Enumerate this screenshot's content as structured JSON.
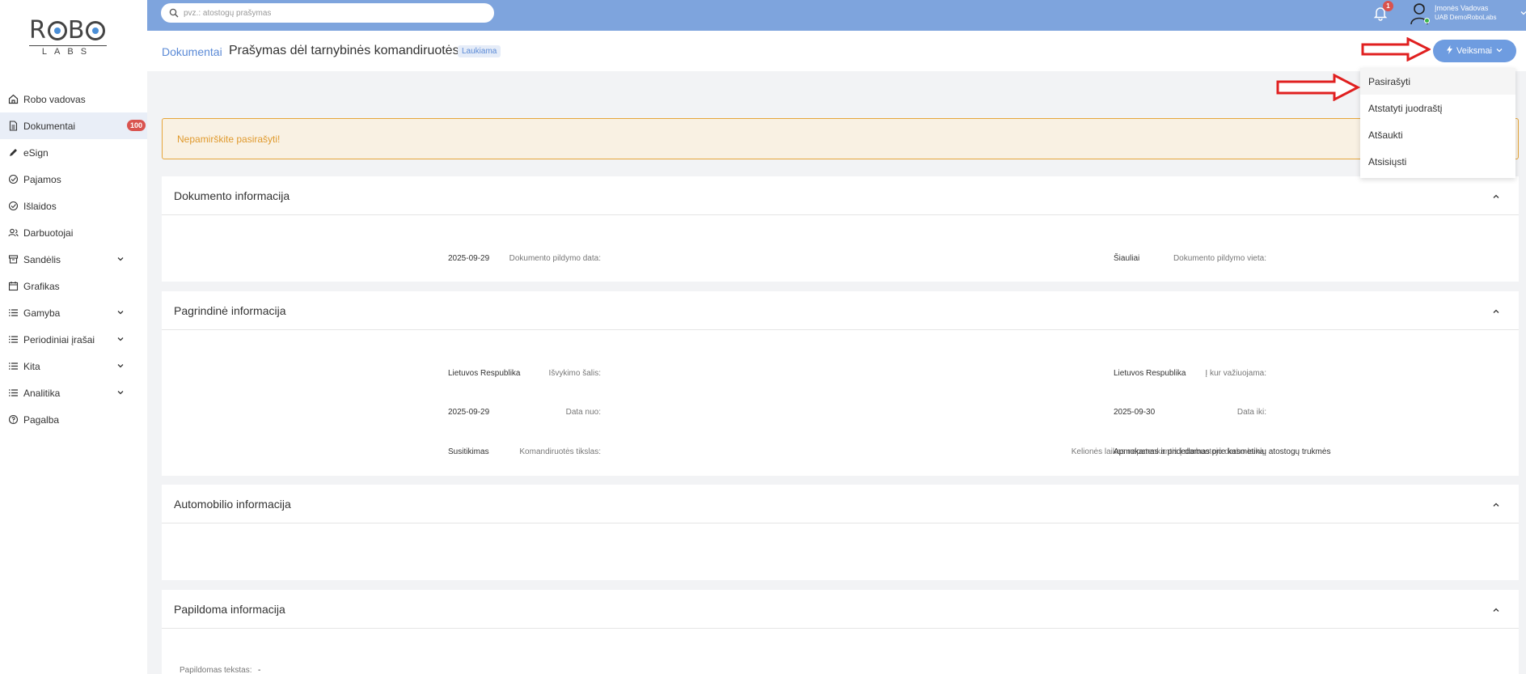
{
  "brand": {
    "logo_top": "ROBO",
    "logo_bottom": "LABS"
  },
  "sidebar": {
    "items": [
      {
        "label": "Robo vadovas",
        "icon": "home-icon"
      },
      {
        "label": "Dokumentai",
        "icon": "document-icon",
        "badge": "100",
        "active": true
      },
      {
        "label": "eSign",
        "icon": "pen-icon"
      },
      {
        "label": "Pajamos",
        "icon": "income-icon"
      },
      {
        "label": "Išlaidos",
        "icon": "expense-icon"
      },
      {
        "label": "Darbuotojai",
        "icon": "users-icon"
      },
      {
        "label": "Sandėlis",
        "icon": "warehouse-icon",
        "expandable": true
      },
      {
        "label": "Grafikas",
        "icon": "calendar-icon"
      },
      {
        "label": "Gamyba",
        "icon": "list-icon",
        "expandable": true
      },
      {
        "label": "Periodiniai įrašai",
        "icon": "list-icon",
        "expandable": true
      },
      {
        "label": "Kita",
        "icon": "list-icon",
        "expandable": true
      },
      {
        "label": "Analitika",
        "icon": "list-icon",
        "expandable": true
      },
      {
        "label": "Pagalba",
        "icon": "help-icon"
      }
    ]
  },
  "topbar": {
    "search_placeholder": "pvz.: atostogų prašymas",
    "notification_count": "1",
    "user_name": "Įmonės Vadovas",
    "company": "UAB DemoRoboLabs"
  },
  "header": {
    "breadcrumb": "Dokumentai",
    "title": "Prašymas dėl tarnybinės komandiruotės",
    "status": "Laukiama",
    "actions_label": "Veiksmai"
  },
  "dropdown": {
    "items": [
      "Pasirašyti",
      "Atstatyti juodraštį",
      "Atšaukti",
      "Atsisiųsti"
    ]
  },
  "alert": {
    "text": "Nepamirškite pasirašyti!"
  },
  "cards": {
    "doc_info": {
      "title": "Dokumento informacija",
      "fill_date_label": "Dokumento pildymo data:",
      "fill_date": "2025-09-29",
      "fill_place_label": "Dokumento pildymo vieta:",
      "fill_place": "Šiauliai"
    },
    "main_info": {
      "title": "Pagrindinė informacija",
      "country_label": "Išvykimo šalis:",
      "country": "Lietuvos Respublika",
      "dest_label": "Į kur važiuojama:",
      "dest": "Lietuvos Respublika",
      "date_from_label": "Data nuo:",
      "date_from": "2025-09-29",
      "date_to_label": "Data iki:",
      "date_to": "2025-09-30",
      "purpose_label": "Komandiruotės tikslas:",
      "purpose": "Susitikimas",
      "travel_time_label": "Kelionės laikas nepatenkantis į darbuotojo darbo laiką:",
      "travel_time": "Apmokamas ir pridedamas prie kasmetinių atostogų trukmės"
    },
    "car_info": {
      "title": "Automobilio informacija"
    },
    "extra_info": {
      "title": "Papildoma informacija",
      "text_label": "Papildomas tekstas:",
      "text_value": "-"
    }
  },
  "colors": {
    "topbar": "#7ea4dd",
    "accent": "#6e9ce0",
    "badge": "#d9534f",
    "arrow": "#e02020"
  }
}
